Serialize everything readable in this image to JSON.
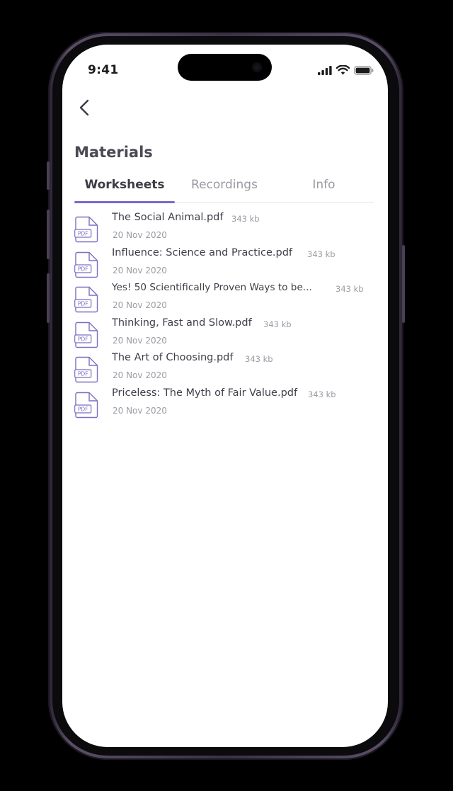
{
  "status_bar": {
    "time": "9:41",
    "icons": [
      "signal-icon",
      "wifi-icon",
      "battery-icon"
    ]
  },
  "header": {
    "back_icon": "chevron-left-icon",
    "title": "Materials"
  },
  "tabs": [
    {
      "label": "Worksheets",
      "active": true
    },
    {
      "label": "Recordings",
      "active": false
    },
    {
      "label": "Info",
      "active": false
    }
  ],
  "files": [
    {
      "name": "The Social Animal.pdf",
      "size": "343 kb",
      "date": "20 Nov 2020",
      "icon": "pdf-file-icon",
      "icon_label": "PDF"
    },
    {
      "name": "Influence: Science and Practice.pdf",
      "size": "343 kb",
      "date": "20 Nov 2020",
      "icon": "pdf-file-icon",
      "icon_label": "PDF"
    },
    {
      "name": "Yes! 50 Scientifically Proven Ways to be...",
      "size": "343 kb",
      "date": "20 Nov 2020",
      "icon": "pdf-file-icon",
      "icon_label": "PDF"
    },
    {
      "name": "Thinking, Fast and Slow.pdf",
      "size": "343 kb",
      "date": "20 Nov 2020",
      "icon": "pdf-file-icon",
      "icon_label": "PDF"
    },
    {
      "name": "The Art of Choosing.pdf",
      "size": "343 kb",
      "date": "20 Nov 2020",
      "icon": "pdf-file-icon",
      "icon_label": "PDF"
    },
    {
      "name": "Priceless: The Myth of Fair Value.pdf",
      "size": "343 kb",
      "date": "20 Nov 2020",
      "icon": "pdf-file-icon",
      "icon_label": "PDF"
    }
  ],
  "colors": {
    "accent": "#7a6ac8",
    "icon_stroke": "#7b6fc2",
    "title_text": "#4a4a55",
    "muted_text": "#9b9ba4",
    "background": "#000000",
    "screen": "#ffffff"
  }
}
